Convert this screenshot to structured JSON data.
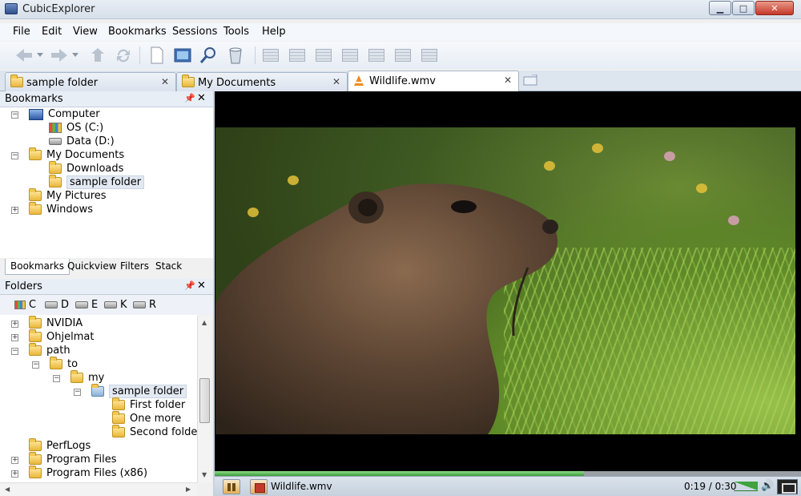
{
  "window": {
    "title": "CubicExplorer"
  },
  "menu": [
    "File",
    "Edit",
    "View",
    "Bookmarks",
    "Sessions",
    "Tools",
    "Help"
  ],
  "tabs": [
    {
      "label": "sample folder",
      "icon": "folder-icon",
      "active": false
    },
    {
      "label": "My Documents",
      "icon": "documents-folder-icon",
      "active": false
    },
    {
      "label": "Wildlife.wmv",
      "icon": "vlc-cone-icon",
      "active": true
    }
  ],
  "bookmarks_panel": {
    "title": "Bookmarks",
    "items": [
      {
        "label": "Computer",
        "icon": "computer-icon",
        "expander": "−"
      },
      {
        "label": "OS (C:)",
        "icon": "windows-drive-icon"
      },
      {
        "label": "Data (D:)",
        "icon": "drive-icon"
      },
      {
        "label": "My Documents",
        "icon": "documents-folder-icon",
        "expander": "−"
      },
      {
        "label": "Downloads",
        "icon": "downloads-folder-icon"
      },
      {
        "label": "sample folder",
        "icon": "folder-icon",
        "selected": true
      },
      {
        "label": "My Pictures",
        "icon": "pictures-folder-icon"
      },
      {
        "label": "Windows",
        "icon": "folder-icon",
        "expander": "+"
      }
    ],
    "bottom_tabs": [
      "Bookmarks",
      "Quickview",
      "Filters",
      "Stack"
    ]
  },
  "folders_panel": {
    "title": "Folders",
    "drives": [
      "C",
      "D",
      "E",
      "K",
      "R"
    ],
    "items": [
      {
        "label": "NVIDIA",
        "expander": "+"
      },
      {
        "label": "Ohjelmat",
        "expander": "+"
      },
      {
        "label": "path",
        "expander": "−"
      },
      {
        "label": "to",
        "expander": "−"
      },
      {
        "label": "my",
        "expander": "−"
      },
      {
        "label": "sample folder",
        "expander": "−",
        "selected": true
      },
      {
        "label": "First folder"
      },
      {
        "label": "One more"
      },
      {
        "label": "Second folder"
      },
      {
        "label": "PerfLogs"
      },
      {
        "label": "Program Files",
        "expander": "+"
      },
      {
        "label": "Program Files (x86)",
        "expander": "+"
      }
    ]
  },
  "player": {
    "file": "Wildlife.wmv",
    "time": "0:19 / 0:30",
    "progress_fraction": 0.63,
    "volume_fraction": 0.9
  },
  "colors": {
    "accent": "#3a9c3a",
    "tab_active_bg": "#ffffff",
    "selection": "#e3e9f2"
  }
}
